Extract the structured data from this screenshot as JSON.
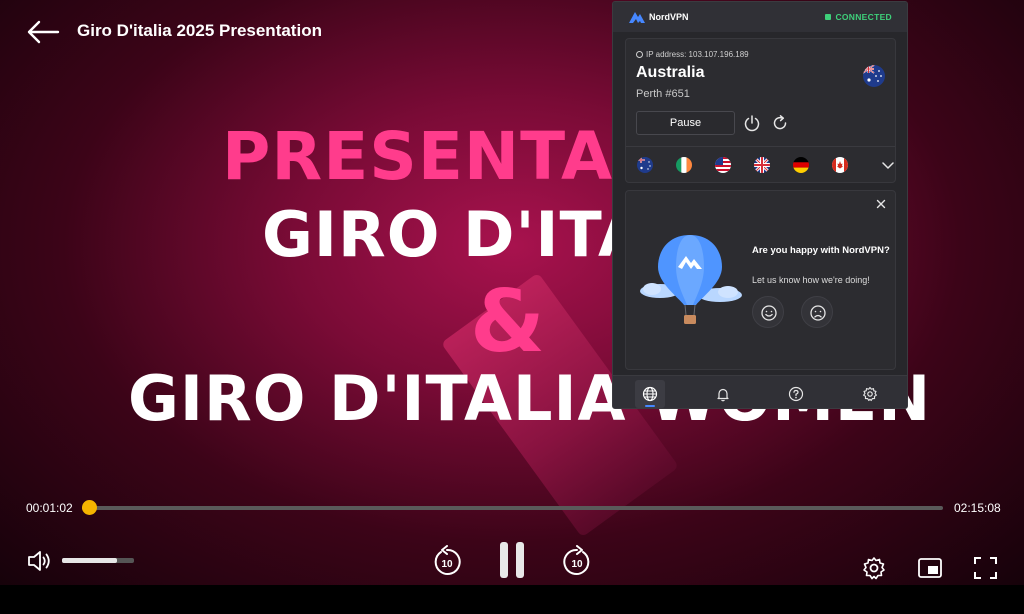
{
  "player": {
    "title": "Giro D'italia 2025 Presentation",
    "current_time": "00:01:02",
    "total_time": "02:15:08",
    "progress_fraction": 0.008,
    "volume_fraction": 0.76,
    "accent_color": "#f5b400",
    "rewind_label": "10",
    "forward_label": "10"
  },
  "video_frame": {
    "line1": "PRESENTAZ",
    "line2": "GIRO D'ITA",
    "line3": "&",
    "line4": "GIRO D'ITALIA WOMEN"
  },
  "vpn": {
    "brand": "NordVPN",
    "status": "CONNECTED",
    "status_color": "#3ed07a",
    "ip_label": "IP address: 103.107.196.189",
    "country": "Australia",
    "server": "Perth #651",
    "pause_label": "Pause",
    "quick_flags": [
      "australia",
      "ireland",
      "united-states",
      "united-kingdom",
      "germany",
      "canada"
    ],
    "feedback": {
      "question": "Are you happy with NordVPN?",
      "subtitle": "Let us know how we're doing!"
    },
    "nav": [
      "globe-icon",
      "bell-icon",
      "help-icon",
      "settings-icon"
    ]
  }
}
